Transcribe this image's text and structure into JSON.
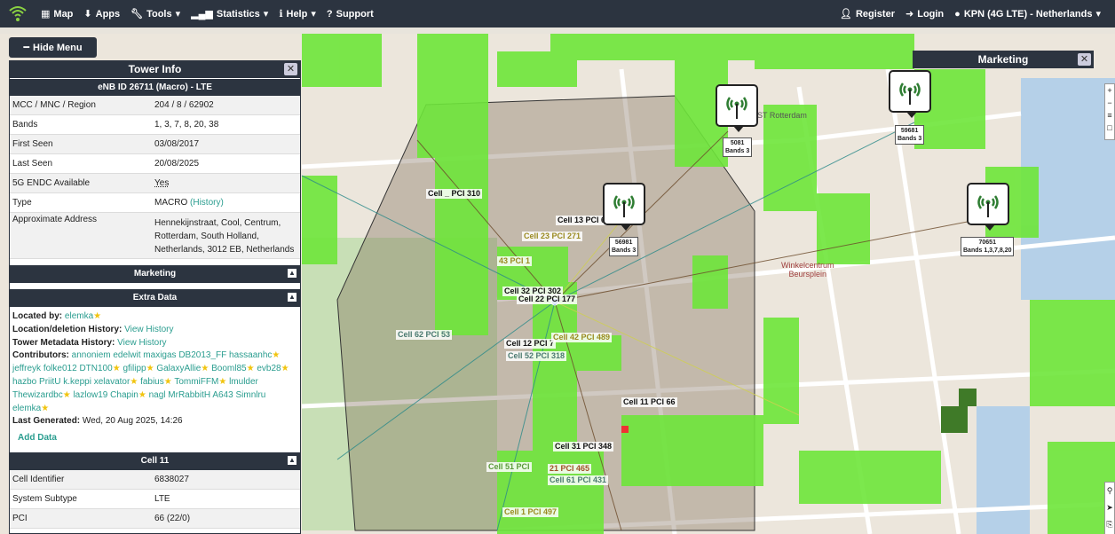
{
  "nav": {
    "map": "Map",
    "apps": "Apps",
    "tools": "Tools",
    "statistics": "Statistics",
    "help": "Help",
    "support": "Support",
    "register": "Register",
    "login": "Login",
    "network": "KPN (4G LTE) - Netherlands"
  },
  "hide_menu": "Hide Menu",
  "tower_info": {
    "title": "Tower Info",
    "close": "✕",
    "subtitle": "eNB ID 26711 (Macro) - LTE",
    "rows": [
      {
        "k": "MCC / MNC / Region",
        "v": "204 / 8 / 62902"
      },
      {
        "k": "Bands",
        "v": "1, 3, 7, 8, 20, 38"
      },
      {
        "k": "First Seen",
        "v": "03/08/2017"
      },
      {
        "k": "Last Seen",
        "v": "20/08/2025"
      },
      {
        "k": "5G ENDC Available",
        "v": "Yes"
      },
      {
        "k": "Type",
        "v": "MACRO",
        "link": "(History)"
      },
      {
        "k": "Approximate Address",
        "v": "Hennekijnstraat, Cool, Centrum, Rotterdam, South Holland, Netherlands, 3012 EB, Netherlands"
      }
    ]
  },
  "marketing_section": "Marketing",
  "extra_section": "Extra Data",
  "extra": {
    "located_by_label": "Located by:",
    "located_by": "elemka",
    "location_history_label": "Location/deletion History:",
    "location_history_link": "View History",
    "metadata_label": "Tower Metadata History:",
    "metadata_link": "View History",
    "contributors_label": "Contributors:",
    "contributors": [
      "annoniem",
      "edelwit",
      "maxigas",
      "DB2013_FF",
      "hassaanhc",
      "jeffreyk",
      "folke012",
      "DTN100",
      "gfilipp",
      "GalaxyAllie",
      "Booml85",
      "evb28",
      "hazbo",
      "PriitU",
      "k.keppi",
      "xelavator",
      "fabius",
      "TommiFFM",
      "lmulder",
      "Thewizardbc",
      "lazlow19",
      "Chapin",
      "nagl",
      "MrRabbitH",
      "A643",
      "Simnlru",
      "elemka"
    ],
    "last_generated_label": "Last Generated:",
    "last_generated": "Wed, 20 Aug 2025, 14:26",
    "add_data": "Add Data"
  },
  "cell_section": "Cell 11",
  "cell_rows": [
    {
      "k": "Cell Identifier",
      "v": "6838027"
    },
    {
      "k": "System Subtype",
      "v": "LTE"
    },
    {
      "k": "PCI",
      "v": "66 (22/0)"
    }
  ],
  "marketing_popup": "Marketing",
  "markers": [
    {
      "id": "5081",
      "bands": "Bands 3"
    },
    {
      "id": "59681",
      "bands": "Bands 3"
    },
    {
      "id": "56981",
      "bands": "Bands 3"
    },
    {
      "id": "70651",
      "bands": "Bands 1,3,7,8,20"
    }
  ],
  "cell_labels": [
    "Cell 13 PCI 6",
    "Cell 23 PCI 271",
    "43 PCI 1",
    "Cell 32 PCI 302",
    "Cell 22 PCI 177",
    "Cell 62 PCI 53",
    "Cell 12 PCI 7",
    "Cell 42 PCI 489",
    "Cell 52 PCI 318",
    "Cell 11 PCI 66",
    "Cell 31 PCI 348",
    "Cell 51 PCI",
    "21 PCI 465",
    "Cell 61 PCI 431",
    "Cell 1 PCI 497",
    "Cell _ PCI 310"
  ],
  "places": {
    "mall": "Winkelcentrum\nBeursplein",
    "post": "POST Rotterdam"
  }
}
